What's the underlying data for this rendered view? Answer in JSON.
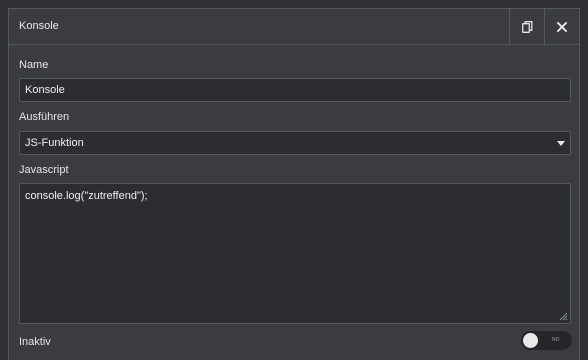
{
  "header": {
    "title": "Konsole",
    "copy_icon": "copy-icon",
    "close_icon": "close-icon"
  },
  "form": {
    "name_label": "Name",
    "name_value": "Konsole",
    "execute_label": "Ausführen",
    "execute_value": "JS-Funktion",
    "javascript_label": "Javascript",
    "javascript_value": "console.log(\"zutreffend\");",
    "inactive_label": "Inaktiv",
    "inactive_toggle_text": "NO"
  },
  "colors": {
    "background": "#2f3136",
    "panel": "#3a3c41",
    "field": "#2b2d31",
    "border": "#55585e",
    "text": "#e6e6e6"
  }
}
